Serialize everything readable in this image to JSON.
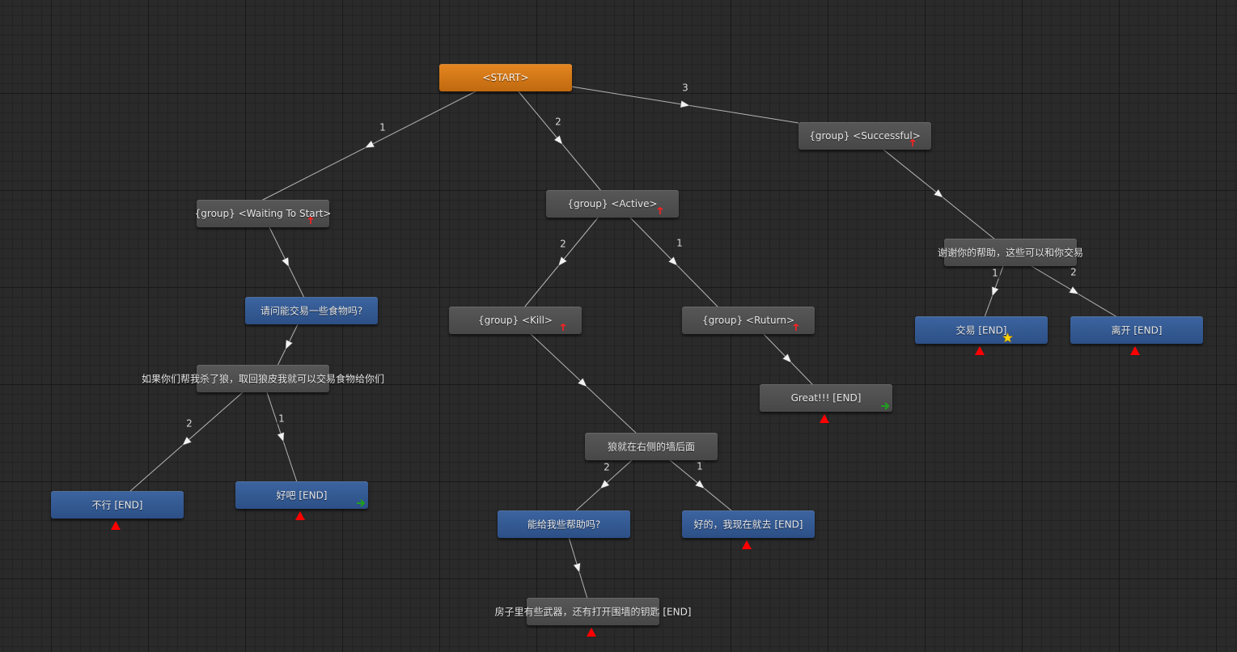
{
  "nodes": {
    "start": {
      "label": "<START>"
    },
    "waiting": {
      "label": "{group} <Waiting To Start>"
    },
    "active": {
      "label": "{group} <Active>"
    },
    "successful": {
      "label": "{group} <Successful>"
    },
    "ask_food": {
      "label": "请问能交易一些食物吗?"
    },
    "kill_wolf_offer": {
      "label": "如果你们帮我杀了狼，取回狼皮我就可以交易食物给你们"
    },
    "refuse_end": {
      "label": "不行 [END]"
    },
    "agree_end": {
      "label": "好吧 [END]"
    },
    "kill": {
      "label": "{group} <Kill>"
    },
    "ruturn": {
      "label": "{group} <Ruturn>"
    },
    "great_end": {
      "label": "Great!!! [END]"
    },
    "wolf_wall": {
      "label": "狼就在右侧的墙后面"
    },
    "need_help": {
      "label": "能给我些帮助吗?"
    },
    "go_now_end": {
      "label": "好的，我现在就去 [END]"
    },
    "weapons_end": {
      "label": "房子里有些武器，还有打开围墙的钥匙 [END]"
    },
    "thanks_trade": {
      "label": "谢谢你的帮助，这些可以和你交易"
    },
    "trade_end": {
      "label": "交易 [END]"
    },
    "leave_end": {
      "label": "离开 [END]"
    }
  },
  "edges": {
    "start_waiting": {
      "num": "1"
    },
    "start_active": {
      "num": "2"
    },
    "start_successful": {
      "num": "3"
    },
    "active_kill": {
      "num": "2"
    },
    "active_ruturn": {
      "num": "1"
    },
    "offer_refuse": {
      "num": "2"
    },
    "offer_agree": {
      "num": "1"
    },
    "wall_help": {
      "num": "2"
    },
    "wall_go": {
      "num": "1"
    },
    "thanks_trade": {
      "num": "1"
    },
    "thanks_leave": {
      "num": "2"
    }
  },
  "icons": {
    "anchor": "anchor-icon",
    "triangle": "red-triangle-icon",
    "arrow": "green-arrow-icon",
    "star": "star-icon"
  },
  "colors": {
    "canvas": "#2a2a2a",
    "gray_node": "#4f4f4f",
    "blue_node": "#34598f",
    "start_node": "#d97a18",
    "edge_line": "#b4b4b4",
    "marker_red": "#ff0000",
    "marker_green": "#1fa01f",
    "star": "#ffd400"
  }
}
